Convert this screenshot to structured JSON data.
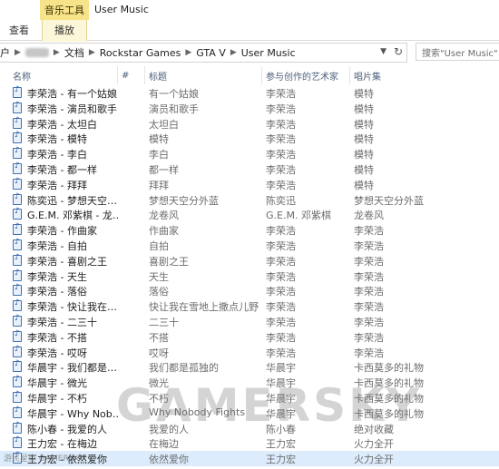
{
  "titlebar": {
    "contextual_tab": "音乐工具",
    "window_title": "User Music"
  },
  "ribbon": {
    "tabs": [
      {
        "label": "查看"
      },
      {
        "label": "播放"
      }
    ]
  },
  "address": {
    "crumbs": [
      "户",
      "文档",
      "Rockstar Games",
      "GTA V",
      "User Music"
    ],
    "search_placeholder": "搜索\"User Music\""
  },
  "columns": {
    "name": "名称",
    "number": "#",
    "title": "标题",
    "artist": "参与创作的艺术家",
    "album": "唱片集"
  },
  "rows": [
    {
      "name": "李荣浩 - 有一个姑娘",
      "title": "有一个姑娘",
      "artist": "李荣浩",
      "album": "模特"
    },
    {
      "name": "李荣浩 - 演员和歌手",
      "title": "演员和歌手",
      "artist": "李荣浩",
      "album": "模特"
    },
    {
      "name": "李荣浩 - 太坦白",
      "title": "太坦白",
      "artist": "李荣浩",
      "album": "模特"
    },
    {
      "name": "李荣浩 - 模特",
      "title": "模特",
      "artist": "李荣浩",
      "album": "模特"
    },
    {
      "name": "李荣浩 - 李白",
      "title": "李白",
      "artist": "李荣浩",
      "album": "模特"
    },
    {
      "name": "李荣浩 - 都一样",
      "title": "都一样",
      "artist": "李荣浩",
      "album": "模特"
    },
    {
      "name": "李荣浩 - 拜拜",
      "title": "拜拜",
      "artist": "李荣浩",
      "album": "模特"
    },
    {
      "name": "陈奕迅 - 梦想天空…",
      "title": "梦想天空分外蓝",
      "artist": "陈奕迅",
      "album": "梦想天空分外蓝"
    },
    {
      "name": "G.E.M. 邓紫棋 - 龙…",
      "title": "龙卷风",
      "artist": "G.E.M. 邓紫棋",
      "album": "龙卷风"
    },
    {
      "name": "李荣浩 - 作曲家",
      "title": "作曲家",
      "artist": "李荣浩",
      "album": "李荣浩"
    },
    {
      "name": "李荣浩 - 自拍",
      "title": "自拍",
      "artist": "李荣浩",
      "album": "李荣浩"
    },
    {
      "name": "李荣浩 - 喜剧之王",
      "title": "喜剧之王",
      "artist": "李荣浩",
      "album": "李荣浩"
    },
    {
      "name": "李荣浩 - 天生",
      "title": "天生",
      "artist": "李荣浩",
      "album": "李荣浩"
    },
    {
      "name": "李荣浩 - 落俗",
      "title": "落俗",
      "artist": "李荣浩",
      "album": "李荣浩"
    },
    {
      "name": "李荣浩 - 快让我在…",
      "title": "快让我在雪地上撒点儿野",
      "artist": "李荣浩",
      "album": "李荣浩"
    },
    {
      "name": "李荣浩 - 二三十",
      "title": "二三十",
      "artist": "李荣浩",
      "album": "李荣浩"
    },
    {
      "name": "李荣浩 - 不搭",
      "title": "不搭",
      "artist": "李荣浩",
      "album": "李荣浩"
    },
    {
      "name": "李荣浩 - 哎呀",
      "title": "哎呀",
      "artist": "李荣浩",
      "album": "李荣浩"
    },
    {
      "name": "华晨宇 - 我们都是…",
      "title": "我们都是孤独的",
      "artist": "华晨宇",
      "album": "卡西莫多的礼物"
    },
    {
      "name": "华晨宇 - 微光",
      "title": "微光",
      "artist": "华晨宇",
      "album": "卡西莫多的礼物"
    },
    {
      "name": "华晨宇 - 不朽",
      "title": "不朽",
      "artist": "华晨宇",
      "album": "卡西莫多的礼物"
    },
    {
      "name": "华晨宇 - Why Nob…",
      "title": "Why Nobody Fights",
      "artist": "华晨宇",
      "album": "卡西莫多的礼物"
    },
    {
      "name": "陈小春 - 我爱的人",
      "title": "我爱的人",
      "artist": "陈小春",
      "album": "绝对收藏"
    },
    {
      "name": "王力宏 - 在梅边",
      "title": "在梅边",
      "artist": "王力宏",
      "album": "火力全开"
    },
    {
      "name": "王力宏 - 依然爱你",
      "title": "依然爱你",
      "artist": "王力宏",
      "album": "火力全开"
    }
  ],
  "watermark": {
    "text": "GAMERSKY",
    "small": "游民星空 GAMERSKY"
  }
}
